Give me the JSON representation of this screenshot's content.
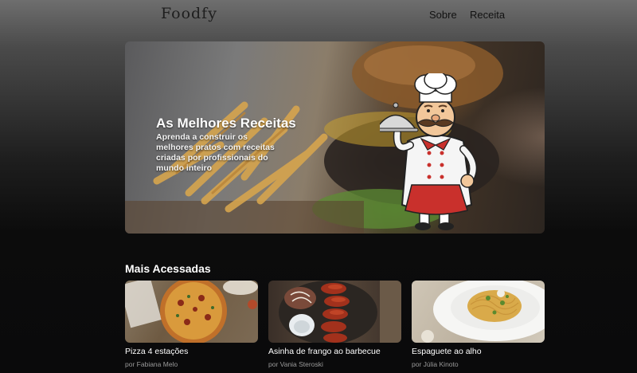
{
  "header": {
    "logo": "Foodfy",
    "nav": [
      {
        "label": "Sobre"
      },
      {
        "label": "Receita"
      }
    ]
  },
  "hero": {
    "title": "As Melhores Receitas",
    "subtitle": "Aprenda a construir os melhores pratos com receitas criadas por profissionais do mundo inteiro"
  },
  "section": {
    "title": "Mais Acessadas"
  },
  "recipes": [
    {
      "name": "Pizza 4 estações",
      "author_prefix": "por",
      "author": "Fabiana Melo",
      "image": "pizza-image"
    },
    {
      "name": "Asinha de frango ao barbecue",
      "author_prefix": "por",
      "author": "Vania Steroski",
      "image": "chicken-wings-image"
    },
    {
      "name": "Espaguete ao alho",
      "author_prefix": "por",
      "author": "Júlia Kinoto",
      "image": "spaghetti-image"
    }
  ]
}
